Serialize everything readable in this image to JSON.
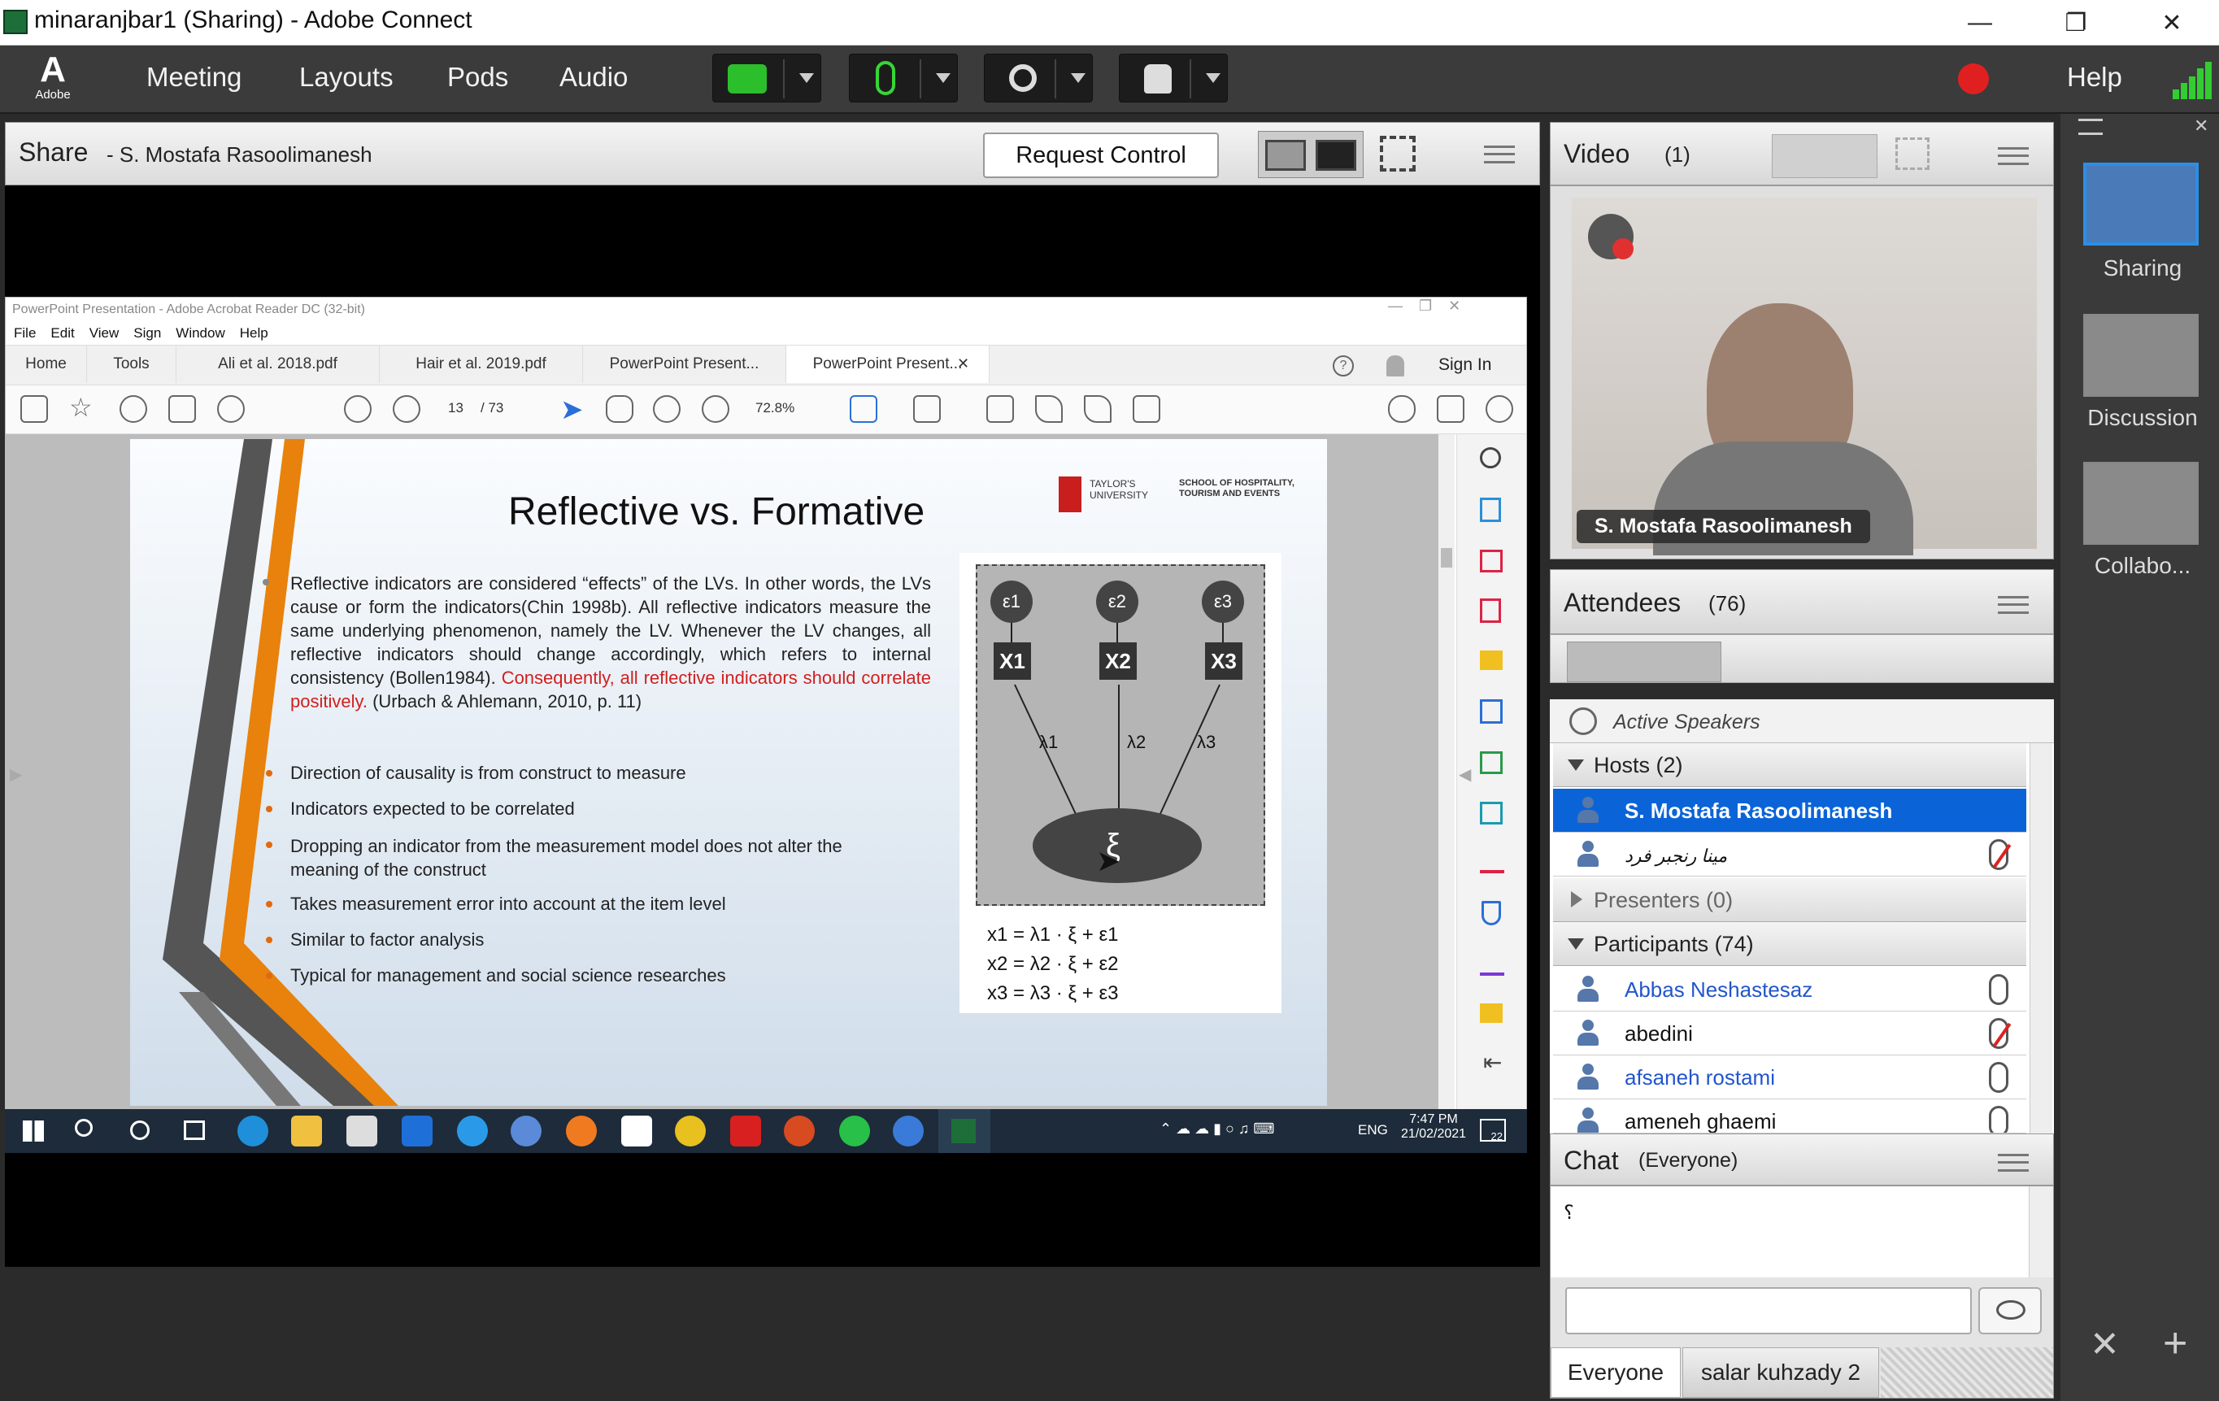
{
  "window": {
    "title": "minaranjbar1 (Sharing) - Adobe Connect"
  },
  "menu": {
    "items": [
      "Meeting",
      "Layouts",
      "Pods",
      "Audio"
    ],
    "help": "Help",
    "logo_text": "Adobe"
  },
  "share": {
    "title": "Share",
    "presenter": "- S. Mostafa Rasoolimanesh",
    "request_control": "Request Control"
  },
  "acrobat": {
    "title": "PowerPoint Presentation - Adobe Acrobat Reader DC (32-bit)",
    "menu": [
      "File",
      "Edit",
      "View",
      "Sign",
      "Window",
      "Help"
    ],
    "tabs": [
      "Home",
      "Tools",
      "Ali et al. 2018.pdf",
      "Hair et al. 2019.pdf",
      "PowerPoint Present...",
      "PowerPoint Present..."
    ],
    "sign_in": "Sign In",
    "page_current": "13",
    "page_total": "/ 73",
    "zoom": "72.8%"
  },
  "slide": {
    "title": "Reflective vs. Formative",
    "logo_left": "TAYLOR'S UNIVERSITY",
    "logo_right": "SCHOOL OF HOSPITALITY, TOURISM AND EVENTS",
    "para_black": "Reflective indicators are considered “effects” of the LVs. In other words, the LVs cause or form the indicators(Chin 1998b). All reflective indicators measure the same underlying phenomenon, namely the LV. Whenever the LV changes, all reflective indicators should change accordingly, which refers to internal consistency (Bollen1984).",
    "para_red": "Consequently, all reflective indicators should correlate positively.",
    "para_cite": "(Urbach & Ahlemann, 2010, p. 11)",
    "bullets": [
      "Direction of causality is from construct to measure",
      "Indicators expected to be correlated",
      "Dropping an indicator from the measurement model does not alter the meaning of the construct",
      "Takes measurement error into account at the item level",
      "Similar to factor analysis",
      "Typical for management and social science researches"
    ],
    "diagram": {
      "errors": [
        "ε1",
        "ε2",
        "ε3"
      ],
      "indicators": [
        "X1",
        "X2",
        "X3"
      ],
      "loadings": [
        "λ1",
        "λ2",
        "λ3"
      ],
      "latent": "ξ",
      "equations": [
        "x1 = λ1 · ξ + ε1",
        "x2 = λ2 · ξ + ε2",
        "x3 = λ3 · ξ + ε3"
      ]
    }
  },
  "taskbar": {
    "lang": "ENG",
    "time": "7:47 PM",
    "date": "21/02/2021",
    "notif": "22"
  },
  "video": {
    "title": "Video",
    "count": "(1)",
    "name": "S. Mostafa Rasoolimanesh"
  },
  "attendees": {
    "title": "Attendees",
    "count": "(76)",
    "active_speakers": "Active Speakers",
    "hosts_label": "Hosts (2)",
    "hosts": [
      "S. Mostafa Rasoolimanesh",
      "مینا رنجبر فرد"
    ],
    "presenters_label": "Presenters (0)",
    "participants_label": "Participants (74)",
    "participants": [
      "Abbas  Neshastesaz",
      "abedini",
      "afsaneh rostami",
      "ameneh ghaemi"
    ]
  },
  "chat": {
    "title": "Chat",
    "scope": "(Everyone)",
    "message": "؟",
    "tab_everyone": "Everyone",
    "tab_private": "salar kuhzady 2"
  },
  "layouts": [
    "Sharing",
    "Discussion",
    "Collabo..."
  ],
  "colors": {
    "menubar": "#3b3b3b",
    "selected": "#0a64d8",
    "accent_orange": "#e8820c",
    "record": "#e02020"
  }
}
